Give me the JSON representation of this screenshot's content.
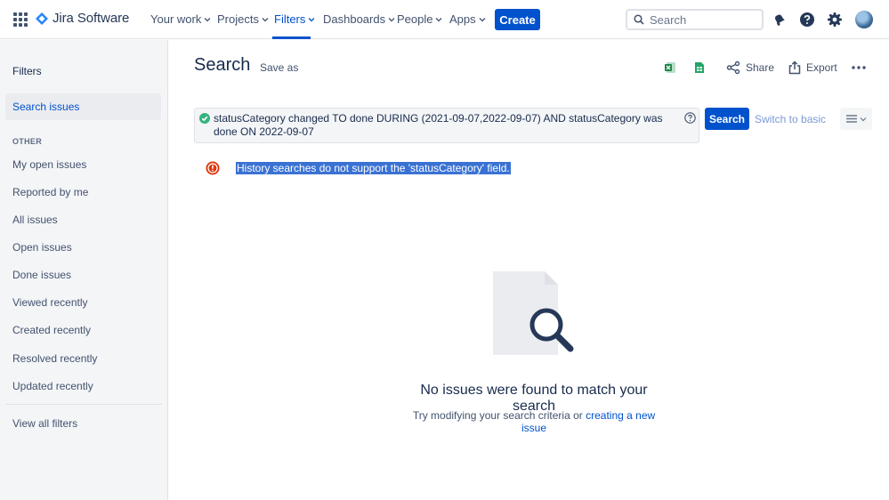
{
  "topnav": {
    "app_name": "Jira Software",
    "items": [
      {
        "label": "Your work"
      },
      {
        "label": "Projects"
      },
      {
        "label": "Filters"
      },
      {
        "label": "Dashboards"
      },
      {
        "label": "People"
      },
      {
        "label": "Apps"
      }
    ],
    "active_item": "Filters",
    "create_label": "Create",
    "search_placeholder": "Search",
    "icons": [
      "app-switcher-icon",
      "notification-bell-icon",
      "help-icon",
      "settings-gear-icon",
      "avatar"
    ]
  },
  "sidebar": {
    "title": "Filters",
    "selected": "Search issues",
    "search_issues": "Search issues",
    "section_heading": "OTHER",
    "items": [
      {
        "label": "My open issues"
      },
      {
        "label": "Reported by me"
      },
      {
        "label": "All issues"
      },
      {
        "label": "Open issues"
      },
      {
        "label": "Done issues"
      },
      {
        "label": "Viewed recently"
      },
      {
        "label": "Created recently"
      },
      {
        "label": "Resolved recently"
      },
      {
        "label": "Updated recently"
      }
    ],
    "view_all": "View all filters"
  },
  "main": {
    "title": "Search",
    "save_as": "Save as",
    "toolbar": {
      "share": "Share",
      "export": "Export"
    },
    "jql": "statusCategory changed TO done DURING (2021-09-07,2022-09-07) AND statusCategory was done ON 2022-09-07",
    "search_button": "Search",
    "switch_basic": "Switch to basic",
    "error": "History searches do not support the 'statusCategory' field.",
    "empty_title": "No issues were found to match your search",
    "empty_sub_prefix": "Try modifying your search criteria or ",
    "empty_sub_link": "creating a new issue"
  },
  "colors": {
    "brand_blue": "#0052cc",
    "error_red": "#de350b",
    "success_green": "#36b37e",
    "sidebar_bg": "#f4f5f7"
  }
}
